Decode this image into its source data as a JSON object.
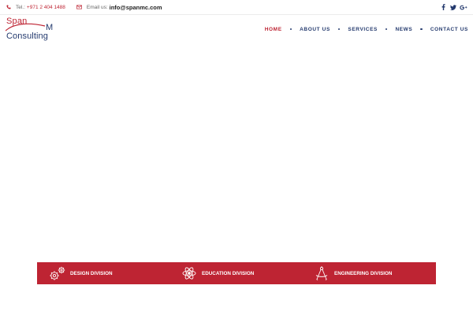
{
  "topbar": {
    "phone_label": "Tel.:",
    "phone_value": "+971 2 404 1488",
    "email_label": "Email us:",
    "email_value": "info@spanmc.com",
    "social_icons": [
      "facebook-icon",
      "twitter-icon",
      "google-plus-icon"
    ]
  },
  "logo": {
    "line1": "Span",
    "line1_right": "M",
    "line2": "Consulting"
  },
  "nav": {
    "items": [
      {
        "label": "HOME",
        "active": true
      },
      {
        "label": "ABOUT US",
        "active": false
      },
      {
        "label": "SERVICES",
        "active": false
      },
      {
        "label": "NEWS",
        "active": false
      },
      {
        "label": "CONTACT US",
        "active": false
      }
    ]
  },
  "divisions": [
    {
      "label": "DESIGN DIVISION",
      "icon": "gears-icon"
    },
    {
      "label": "EDUCATION DIVISION",
      "icon": "atom-icon"
    },
    {
      "label": "ENGINEERING DIVISION",
      "icon": "compass-icon"
    }
  ],
  "colors": {
    "accent": "#be2433",
    "navy": "#243a6e"
  }
}
